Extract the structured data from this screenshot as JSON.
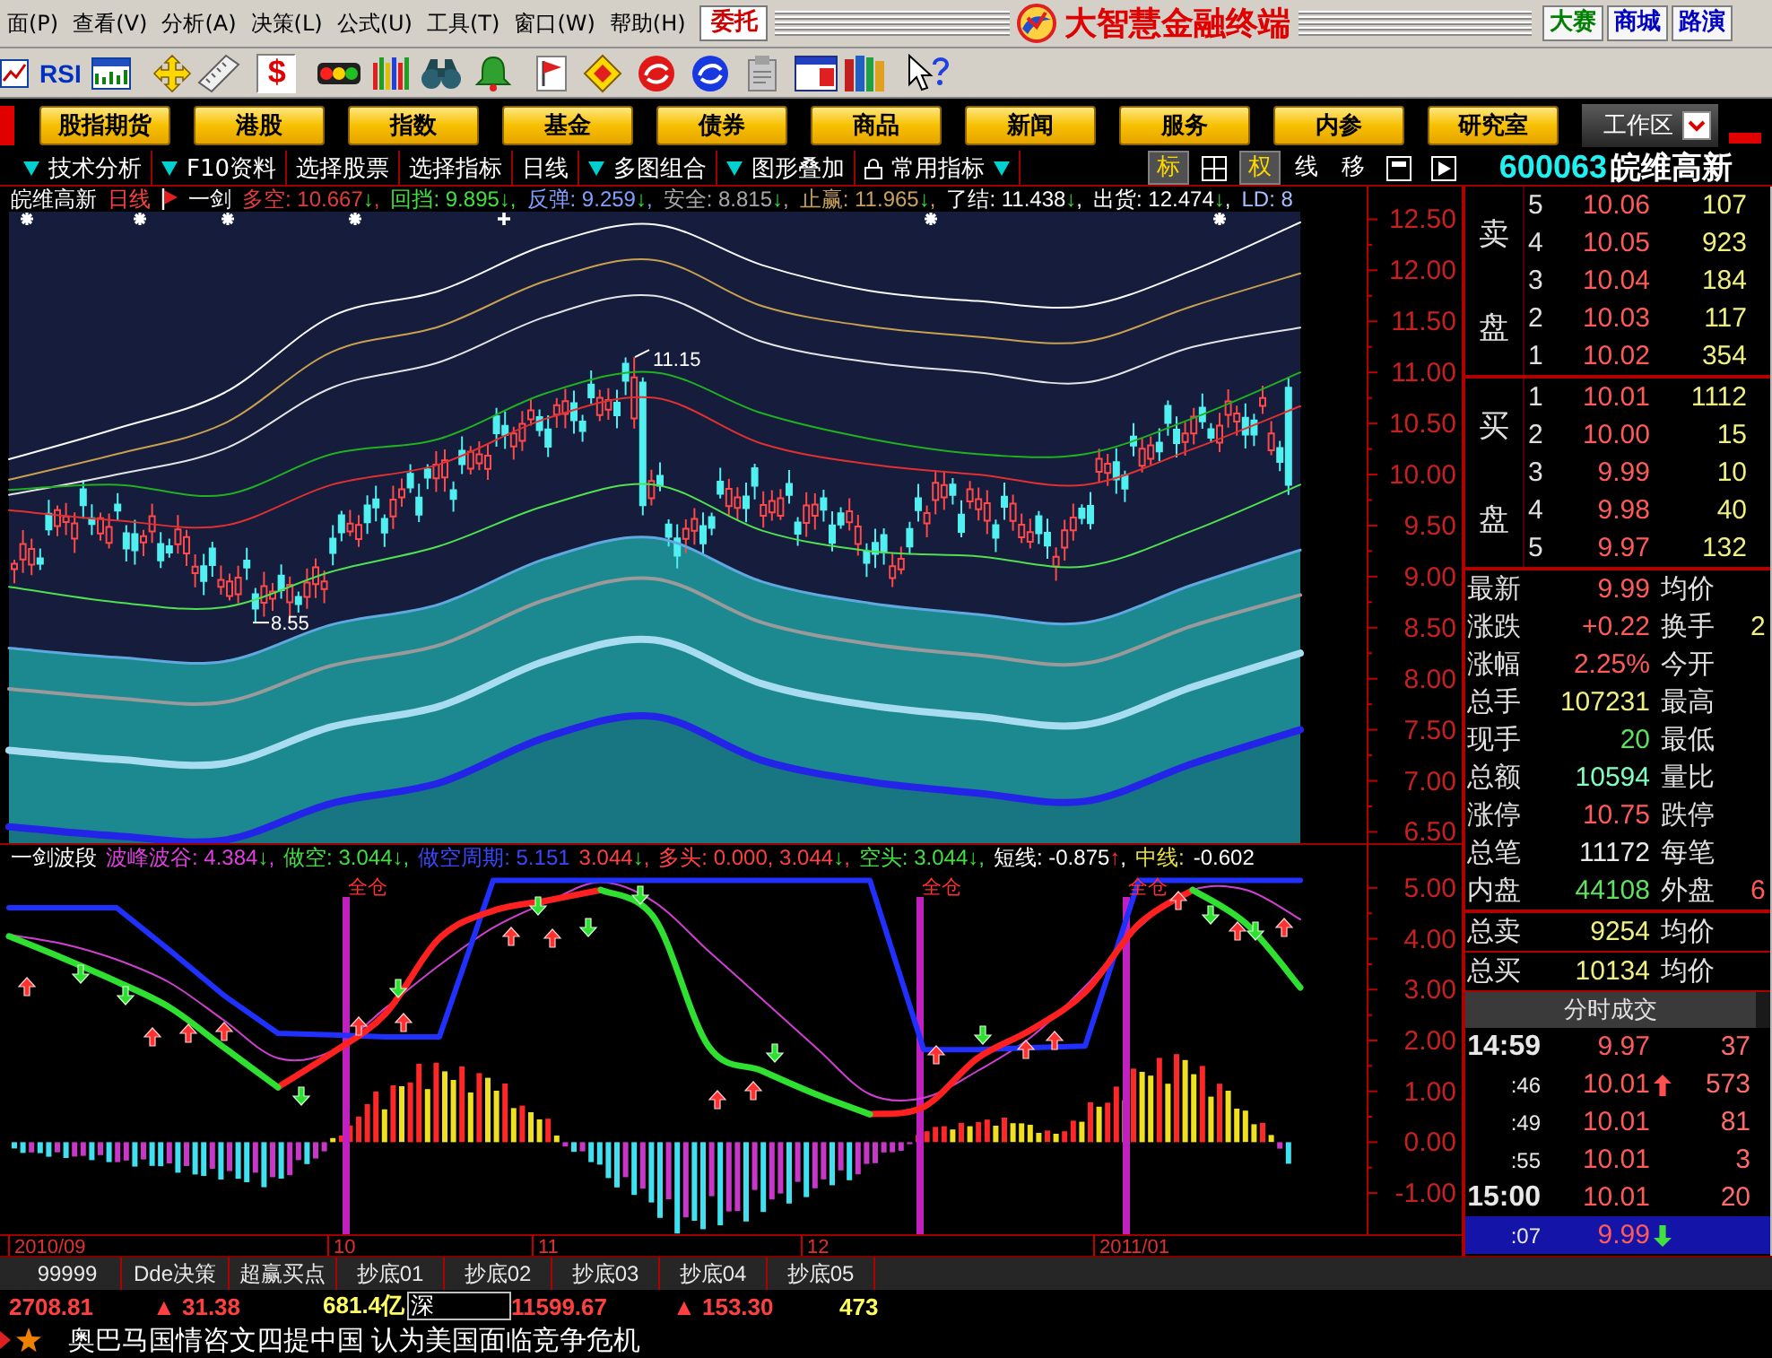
{
  "menu_bar": {
    "items": [
      "面(P)",
      "查看(V)",
      "分析(A)",
      "决策(L)",
      "公式(U)",
      "工具(T)",
      "窗口(W)",
      "帮助(H)"
    ],
    "order_button": "委托",
    "app_title": "大智慧金融终端",
    "links": [
      {
        "label": "大赛",
        "color": "#008000"
      },
      {
        "label": "商城",
        "color": "#0000c0"
      },
      {
        "label": "路演",
        "color": "#0000c0"
      }
    ]
  },
  "toolbar": {
    "text_buttons": [
      {
        "label": "RSI",
        "pressed": false
      },
      {
        "label": "$",
        "pressed": true
      }
    ]
  },
  "nav": {
    "buttons": [
      "股指期货",
      "港股",
      "指数",
      "基金",
      "债券",
      "商品",
      "新闻",
      "服务",
      "内参",
      "研究室"
    ],
    "workspace": "工作区"
  },
  "chart_tabs": [
    {
      "label": "技术分析",
      "dropdown_before": true
    },
    {
      "label": "F10资料",
      "dropdown_before": true
    },
    {
      "label": "选择股票"
    },
    {
      "label": "选择指标"
    },
    {
      "label": "日线"
    },
    {
      "label": "多图组合",
      "dropdown_before": true
    },
    {
      "label": "图形叠加",
      "dropdown_before": true
    },
    {
      "label": "常用指标",
      "locked": true,
      "dropdown_after": true
    }
  ],
  "view_buttons": [
    {
      "label": "标",
      "on": true
    },
    {
      "label": "权",
      "on": true
    },
    {
      "label": "线",
      "on": false
    },
    {
      "label": "移",
      "on": false
    }
  ],
  "security": {
    "code": "600063",
    "name": "皖维高新"
  },
  "main_chart": {
    "name": "皖维高新",
    "period": "日线",
    "formula": "一剑",
    "indicators": [
      {
        "text": "多空: 10.667",
        "arrow": "↓",
        "rising": false,
        "suffix": ",",
        "color": "#e03c3c"
      },
      {
        "text": "回挡: 9.895",
        "arrow": "↓",
        "rising": false,
        "suffix": ",",
        "color": "#40e040"
      },
      {
        "text": "反弹: 9.259",
        "arrow": "↓",
        "rising": false,
        "suffix": ",",
        "color": "#7fa0ff"
      },
      {
        "text": "安全: 8.815",
        "arrow": "↓",
        "rising": false,
        "suffix": ",",
        "color": "#a8a8a8"
      },
      {
        "text": "止赢: 11.965",
        "arrow": "↓",
        "rising": false,
        "suffix": ",",
        "color": "#c8a060"
      },
      {
        "text": "了结: 11.438",
        "arrow": "↓",
        "rising": false,
        "suffix": ",",
        "color": "#ffffff"
      },
      {
        "text": "出货: 12.474",
        "arrow": "↓",
        "rising": false,
        "suffix": ",",
        "color": "#ffffff"
      },
      {
        "text": "LD: 8",
        "color": "#a0c0ff"
      }
    ],
    "chart_data": {
      "type": "line",
      "ylim": [
        6.39,
        12.82
      ],
      "yticks": [
        {
          "value": 12.5,
          "label": "12.50"
        },
        {
          "value": 12,
          "label": "12.00"
        },
        {
          "value": 11.5,
          "label": "11.50"
        },
        {
          "value": 11,
          "label": "11.00"
        },
        {
          "value": 10.5,
          "label": "10.50"
        },
        {
          "value": 10,
          "label": "10.00"
        },
        {
          "value": 9.5,
          "label": "9.50"
        },
        {
          "value": 9,
          "label": "9.00"
        },
        {
          "value": 8.5,
          "label": "8.50"
        },
        {
          "value": 8,
          "label": "8.00"
        },
        {
          "value": 7.5,
          "label": "7.50"
        },
        {
          "value": 7,
          "label": "7.00"
        },
        {
          "value": 6.5,
          "label": "6.50"
        }
      ],
      "series": [
        {
          "color": "#fafafa",
          "values": [
            10.15,
            10.45,
            10.8,
            11.55,
            11.8,
            12.25,
            12.45,
            12.05,
            11.8,
            11.7,
            11.65,
            12.0,
            12.47
          ]
        },
        {
          "color": "#c8a050",
          "values": [
            9.95,
            10.2,
            10.5,
            11.2,
            11.45,
            11.9,
            12.1,
            11.65,
            11.45,
            11.35,
            11.3,
            11.65,
            11.97
          ]
        },
        {
          "color": "#e4e4e4",
          "values": [
            9.8,
            10.0,
            10.25,
            10.85,
            11.1,
            11.55,
            11.75,
            11.3,
            11.1,
            11.0,
            10.9,
            11.25,
            11.44
          ]
        },
        {
          "color": "#20b020",
          "values": [
            9.85,
            9.9,
            9.8,
            10.2,
            10.35,
            10.8,
            11.0,
            10.6,
            10.35,
            10.2,
            10.2,
            10.55,
            11.0
          ]
        },
        {
          "color": "#e03030",
          "values": [
            9.65,
            9.55,
            9.5,
            9.9,
            10.1,
            10.55,
            10.75,
            10.3,
            10.1,
            10.0,
            9.9,
            10.25,
            10.67
          ]
        },
        {
          "color": "#50e050",
          "values": [
            8.9,
            8.75,
            8.7,
            9.05,
            9.3,
            9.7,
            9.9,
            9.45,
            9.25,
            9.2,
            9.1,
            9.45,
            9.9
          ]
        },
        {
          "color": "#60a8e0",
          "values": [
            8.3,
            8.21,
            8.17,
            8.53,
            8.73,
            9.18,
            9.38,
            8.95,
            8.74,
            8.63,
            8.55,
            8.92,
            9.26
          ]
        },
        {
          "color": "#9a9a9a",
          "values": [
            7.9,
            7.81,
            7.77,
            8.13,
            8.33,
            8.78,
            8.98,
            8.55,
            8.34,
            8.23,
            8.15,
            8.52,
            8.82
          ]
        },
        {
          "color": "#a8dcf0",
          "values": [
            7.3,
            7.21,
            7.17,
            7.53,
            7.73,
            8.18,
            8.38,
            7.95,
            7.74,
            7.63,
            7.55,
            7.92,
            8.25
          ]
        },
        {
          "color": "#2424e8",
          "values": [
            6.55,
            6.46,
            6.42,
            6.78,
            6.98,
            7.43,
            7.63,
            7.2,
            6.99,
            6.88,
            6.8,
            7.17,
            7.5
          ]
        }
      ]
    },
    "markers": [
      "11.15",
      "8.55"
    ]
  },
  "sub_chart": {
    "title": "一剑波段",
    "indicators": [
      {
        "text": "波峰波谷: 4.384",
        "arrow": "↓",
        "rising": false,
        "suffix": ",",
        "color": "#e040e0"
      },
      {
        "text": "做空: 3.044",
        "arrow": "↓",
        "rising": false,
        "suffix": ",",
        "color": "#40e040"
      },
      {
        "text": "做空周期: 5.151",
        "color": "#3848ff"
      },
      {
        "text": "3.044",
        "arrow": "↓",
        "rising": false,
        "suffix": ",",
        "color": "#ff4040"
      },
      {
        "text": "多头: 0.000, 3.044",
        "arrow": "↓",
        "rising": false,
        "suffix": ",",
        "color": "#ff4040"
      },
      {
        "text": "空头: 3.044",
        "arrow": "↓",
        "rising": false,
        "suffix": ",",
        "color": "#40e040"
      },
      {
        "text": "短线: -0.875",
        "arrow": "↑",
        "rising": true,
        "suffix": ",",
        "color": "#ffffff"
      },
      {
        "text": "中线:",
        "color": "#e8e040"
      },
      {
        "text": "-0.602",
        "color": "#ffffff"
      }
    ],
    "chart_data": {
      "type": "line",
      "ylim": [
        -1.81,
        5.88
      ],
      "yticks": [
        {
          "value": 5,
          "label": "5.00"
        },
        {
          "value": 4,
          "label": "4.00"
        },
        {
          "value": 3,
          "label": "3.00"
        },
        {
          "value": 2,
          "label": "2.00"
        },
        {
          "value": 1,
          "label": "1.00"
        },
        {
          "value": 0,
          "label": "0.00"
        },
        {
          "value": -1,
          "label": "-1.00"
        }
      ],
      "series": [
        {
          "color": "#d040d0",
          "values": [
            4.08,
            3.9,
            3.59,
            3.13,
            2.39,
            1.65,
            1.79,
            2.64,
            3.48,
            4.22,
            4.72,
            5.11,
            4.72,
            3.76,
            2.81,
            1.86,
            0.94,
            0.87,
            1.4,
            2.07,
            3.06,
            4.22,
            4.96,
            4.96,
            4.38
          ]
        },
        {
          "color": "#2030ff",
          "values": [
            4.61,
            4.61,
            4.61,
            3.76,
            2.88,
            2.14,
            2.11,
            2.07,
            2.07,
            5.15,
            5.15,
            5.15,
            5.15,
            5.15,
            5.15,
            5.15,
            5.15,
            1.82,
            1.82,
            1.86,
            1.89,
            5.15,
            5.15,
            5.15,
            5.15
          ]
        },
        {
          "color": "#ff2020",
          "values": [
            null,
            null,
            null,
            null,
            null,
            1.08,
            1.75,
            2.53,
            4.01,
            4.55,
            4.75,
            4.96,
            null,
            null,
            null,
            null,
            0.55,
            0.69,
            1.65,
            2.21,
            2.95,
            4.29,
            4.96,
            null,
            null
          ]
        },
        {
          "color": "#30e030",
          "values": [
            4.05,
            3.62,
            3.16,
            2.64,
            1.86,
            1.08,
            null,
            null,
            null,
            null,
            null,
            4.96,
            4.4,
            1.89,
            1.4,
            0.94,
            0.55,
            null,
            null,
            null,
            null,
            null,
            4.96,
            4.29,
            3.04
          ]
        }
      ]
    },
    "signals": [
      "全仓",
      "全仓",
      "全仓"
    ]
  },
  "date_axis": [
    "2010/09",
    "10",
    "11",
    "12",
    "2011/01"
  ],
  "order_book": {
    "sell_label": [
      "卖",
      "盘"
    ],
    "sell": [
      {
        "rank": "5",
        "price": "10.06",
        "volume": "107"
      },
      {
        "rank": "4",
        "price": "10.05",
        "volume": "923"
      },
      {
        "rank": "3",
        "price": "10.04",
        "volume": "184"
      },
      {
        "rank": "2",
        "price": "10.03",
        "volume": "117"
      },
      {
        "rank": "1",
        "price": "10.02",
        "volume": "354"
      }
    ],
    "buy_label": [
      "买",
      "盘"
    ],
    "buy": [
      {
        "rank": "1",
        "price": "10.01",
        "volume": "1112"
      },
      {
        "rank": "2",
        "price": "10.00",
        "volume": "15"
      },
      {
        "rank": "3",
        "price": "9.99",
        "volume": "10"
      },
      {
        "rank": "4",
        "price": "9.98",
        "volume": "40"
      },
      {
        "rank": "5",
        "price": "9.97",
        "volume": "132"
      }
    ]
  },
  "stats": [
    {
      "left": {
        "label": "最新",
        "value": "9.99",
        "color": "#ff5a5a"
      },
      "right": {
        "label": "均价"
      }
    },
    {
      "left": {
        "label": "涨跌",
        "value": "+0.22",
        "color": "#ff5a5a"
      },
      "right": {
        "label": "换手",
        "value": "2",
        "color": "#f0f080"
      }
    },
    {
      "left": {
        "label": "涨幅",
        "value": "2.25%",
        "color": "#ff5a5a"
      },
      "right": {
        "label": "今开"
      }
    },
    {
      "left": {
        "label": "总手",
        "value": "107231",
        "color": "#f0f080"
      },
      "right": {
        "label": "最高"
      }
    },
    {
      "left": {
        "label": "现手",
        "value": "20",
        "color": "#60e060"
      },
      "right": {
        "label": "最低"
      }
    },
    {
      "left": {
        "label": "总额",
        "value": "10594",
        "color": "#80ffc0"
      },
      "right": {
        "label": "量比"
      }
    },
    {
      "left": {
        "label": "涨停",
        "value": "10.75",
        "color": "#ff5a5a"
      },
      "right": {
        "label": "跌停"
      }
    },
    {
      "left": {
        "label": "总笔",
        "value": "11172",
        "color": "#e8e8e8"
      },
      "right": {
        "label": "每笔"
      }
    },
    {
      "left": {
        "label": "内盘",
        "value": "44108",
        "color": "#60e060"
      },
      "right": {
        "label": "外盘",
        "value": "6",
        "color": "#ff5a5a"
      }
    }
  ],
  "totals": [
    {
      "label": "总卖",
      "value": "9254",
      "label2": "均价"
    },
    {
      "label": "总买",
      "value": "10134",
      "label2": "均价"
    }
  ],
  "trades": {
    "title": "分时成交",
    "rows": [
      {
        "time": "14:59",
        "kind": "full",
        "price": "9.97",
        "volume": "37",
        "selected": false
      },
      {
        "time": ":46",
        "kind": "short",
        "price": "10.01",
        "uptick": true,
        "volume": "573",
        "selected": false
      },
      {
        "time": ":49",
        "kind": "short",
        "price": "10.01",
        "volume": "81",
        "selected": false
      },
      {
        "time": ":55",
        "kind": "short",
        "price": "10.01",
        "volume": "3",
        "selected": false
      },
      {
        "time": "15:00",
        "kind": "full",
        "price": "10.01",
        "volume": "20",
        "selected": false
      },
      {
        "time": ":07",
        "kind": "short",
        "price": "9.99",
        "downtick": true,
        "selected": true
      }
    ]
  },
  "bottom_tabs": [
    "99999",
    "Dde决策",
    "超赢买点",
    "抄底01",
    "抄底02",
    "抄底03",
    "抄底04",
    "抄底05"
  ],
  "index_bar": [
    {
      "text": "2708.81",
      "kind": "value",
      "color": "#ff4040"
    },
    {
      "text": "▲ 31.38",
      "kind": "value",
      "color": "#ff4040"
    },
    {
      "text": "681.4亿",
      "kind": "value",
      "color": "#ffff60"
    },
    {
      "text": "深",
      "kind": "market"
    },
    {
      "text": "11599.67",
      "kind": "value",
      "color": "#ff4040"
    },
    {
      "text": "▲ 153.30",
      "kind": "value",
      "color": "#ff4040"
    },
    {
      "text": "473",
      "kind": "value",
      "color": "#ffff60"
    }
  ],
  "news": {
    "headline": "奥巴马国情咨文四提中国 认为美国面临竞争危机"
  }
}
